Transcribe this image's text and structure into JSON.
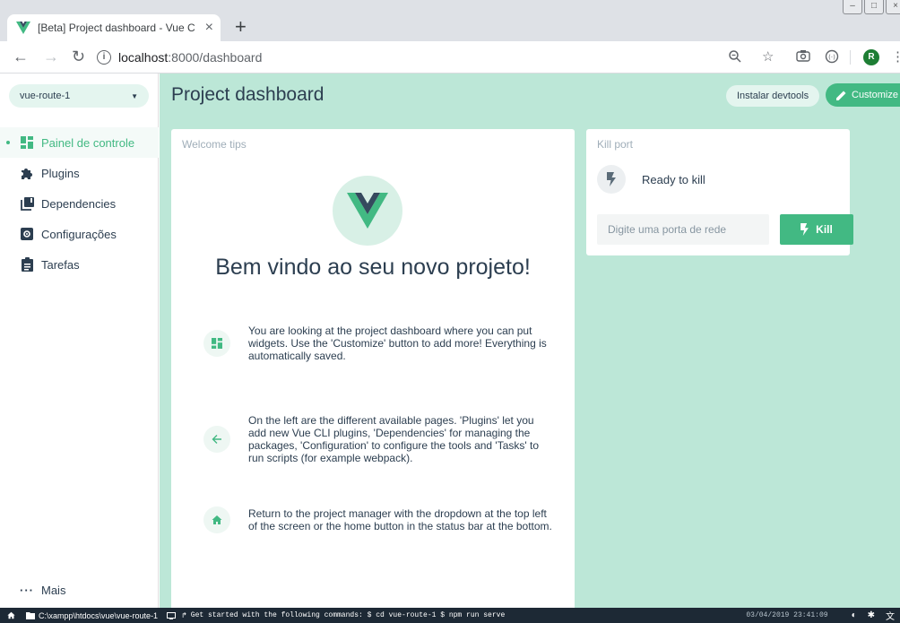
{
  "browser": {
    "tab_title": "[Beta] Project dashboard - Vue C",
    "url_host": "localhost",
    "url_path": ":8000/dashboard",
    "profile_initial": "R"
  },
  "app": {
    "project_selector": "vue-route-1",
    "nav": [
      {
        "label": "Painel de controle",
        "icon": "dashboard-icon",
        "active": true
      },
      {
        "label": "Plugins",
        "icon": "puzzle-icon",
        "active": false
      },
      {
        "label": "Dependencies",
        "icon": "library-icon",
        "active": false
      },
      {
        "label": "Configurações",
        "icon": "settings-icon",
        "active": false
      },
      {
        "label": "Tarefas",
        "icon": "assignment-icon",
        "active": false
      }
    ],
    "more_label": "Mais",
    "page_title": "Project dashboard",
    "devtools_button": "Instalar devtools",
    "customize_button": "Customize"
  },
  "welcome": {
    "card_title": "Welcome tips",
    "heading": "Bem vindo ao seu novo projeto!",
    "tips": [
      {
        "icon": "dashboard-icon",
        "text": "You are looking at the project dashboard where you can put widgets. Use the 'Customize' button to add more! Everything is automatically saved."
      },
      {
        "icon": "arrow-back-icon",
        "text": "On the left are the different available pages. 'Plugins' let you add new Vue CLI plugins, 'Dependencies' for managing the packages, 'Configuration' to configure the tools and 'Tasks' to run scripts (for example webpack)."
      },
      {
        "icon": "home-icon",
        "text": "Return to the project manager with the dropdown at the top left of the screen or the home button in the status bar at the bottom."
      }
    ]
  },
  "kill_port": {
    "card_title": "Kill port",
    "status": "Ready to kill",
    "input_placeholder": "Digite uma porta de rede",
    "button": "Kill"
  },
  "statusbar": {
    "path": "C:\\xampp\\htdocs\\vue\\vue-route-1",
    "log": "Get started with the following commands: $ cd vue-route-1 $ npm run serve",
    "timestamp": "03/04/2019 23:41:09"
  },
  "colors": {
    "accent": "#42b983",
    "content_bg": "#bce7d7",
    "statusbar_bg": "#1d2935",
    "vue_dark": "#35495e"
  }
}
